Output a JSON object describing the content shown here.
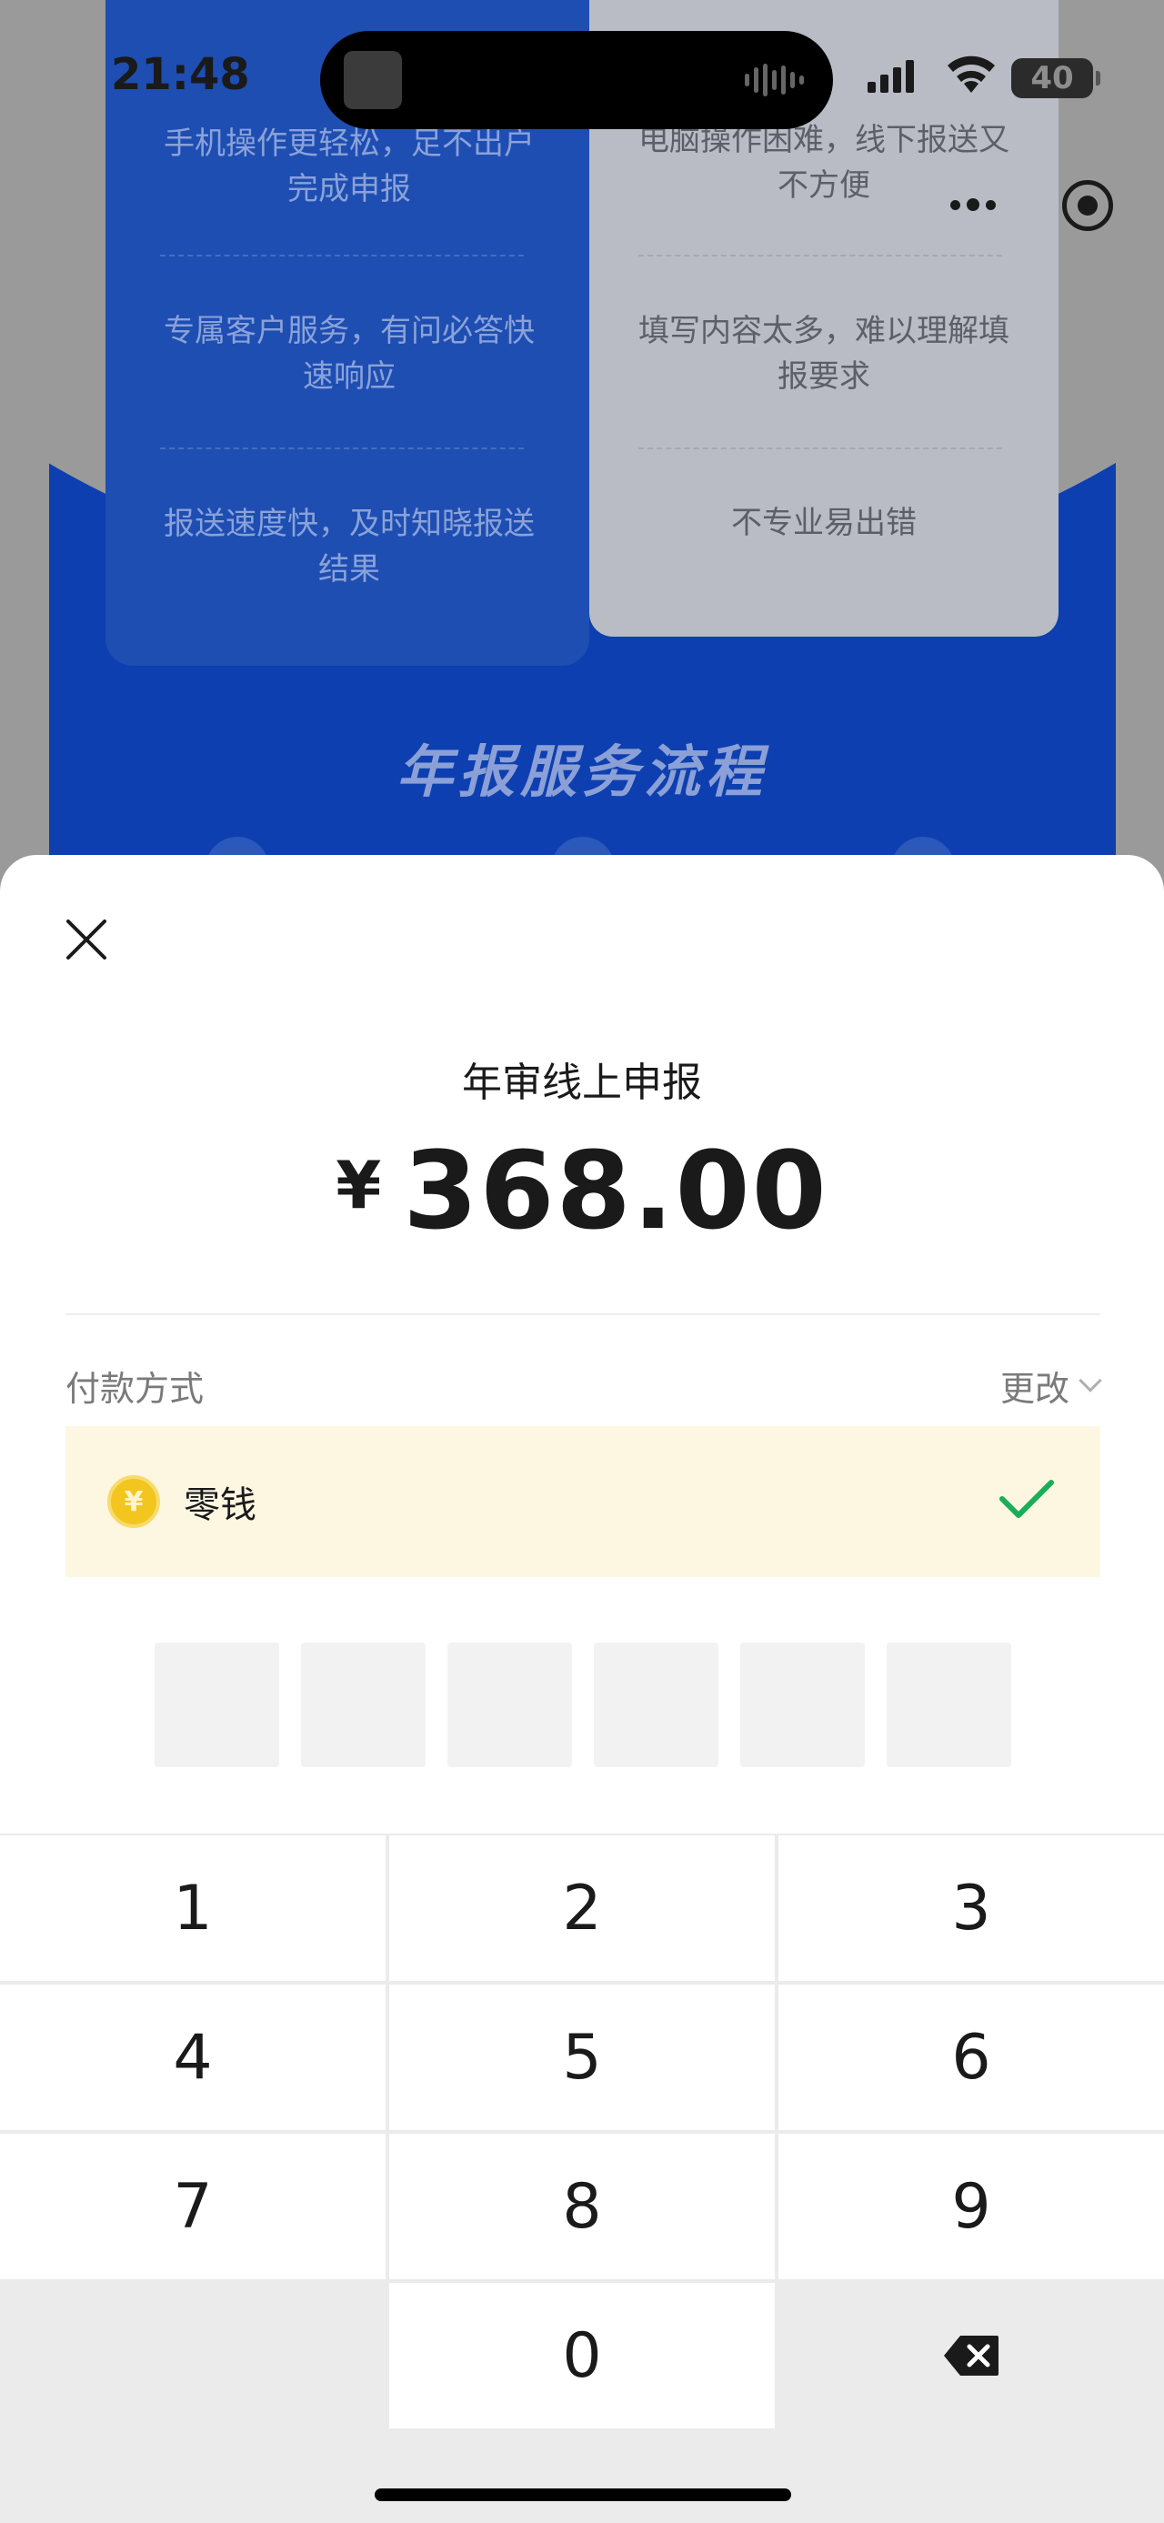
{
  "status_bar": {
    "time": "21:48",
    "battery": "40"
  },
  "background": {
    "left_column": [
      "手机操作更轻松，足不出户完成申报",
      "专属客户服务，有问必答快速响应",
      "报送速度快，及时知晓报送结果"
    ],
    "right_column": [
      "电脑操作困难，线下报送又不方便",
      "填写内容太多，难以理解填报要求",
      "不专业易出错"
    ],
    "section_title": "年报服务流程"
  },
  "payment": {
    "title": "年审线上申报",
    "currency_symbol": "¥",
    "amount": "368.00",
    "method_label": "付款方式",
    "change_label": "更改",
    "method_name": "零钱",
    "coin_glyph": "¥"
  },
  "keypad": {
    "keys": [
      "1",
      "2",
      "3",
      "4",
      "5",
      "6",
      "7",
      "8",
      "9",
      "0"
    ]
  },
  "icons": {
    "close": "close-icon",
    "check": "check-icon",
    "backspace": "backspace-icon",
    "chevron": "chevron-down-icon",
    "more": "more-dots-icon",
    "target": "close-miniprogram-icon"
  },
  "colors": {
    "accent_green": "#1aad5a",
    "brand_blue": "#0d3fb0",
    "method_bg": "#fdf7e2",
    "coin": "#f2c51f"
  }
}
